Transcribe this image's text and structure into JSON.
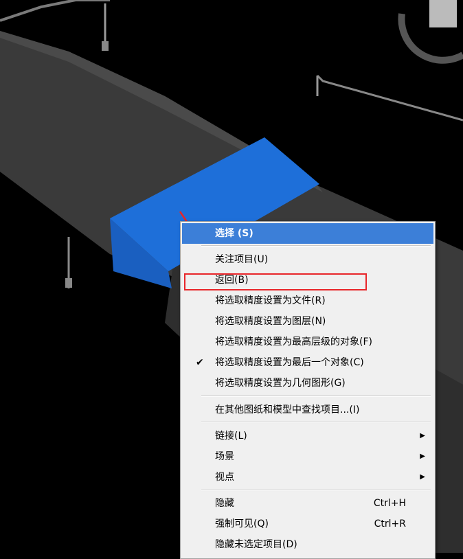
{
  "context_menu": {
    "items": [
      {
        "label": "选择 (S)",
        "highlighted": true
      },
      {
        "label": "关注项目(U)"
      },
      {
        "label": "返回(B)",
        "annotated": true
      },
      {
        "label": "将选取精度设置为文件(R)"
      },
      {
        "label": "将选取精度设置为图层(N)"
      },
      {
        "label": "将选取精度设置为最高层级的对象(F)"
      },
      {
        "label": "将选取精度设置为最后一个对象(C)",
        "checked": true,
        "check_glyph": "✔"
      },
      {
        "label": "将选取精度设置为几何图形(G)"
      },
      {
        "label": "在其他图纸和模型中查找项目...(I)"
      },
      {
        "label": "链接(L)",
        "submenu": true
      },
      {
        "label": "场景",
        "submenu": true
      },
      {
        "label": "视点",
        "submenu": true
      },
      {
        "label": "隐藏",
        "shortcut": "Ctrl+H"
      },
      {
        "label": "强制可见(Q)",
        "shortcut": "Ctrl+R"
      },
      {
        "label": "隐藏未选定项目(D)"
      }
    ],
    "submenu_glyph": "▶"
  },
  "annotation": {
    "arrow_color": "#e8262a",
    "box_color": "#e8262a"
  },
  "colors": {
    "selection_blue": "#1e6fd9",
    "menu_highlight": "#3c7fd8",
    "duct_gray": "#3a3a3a"
  }
}
